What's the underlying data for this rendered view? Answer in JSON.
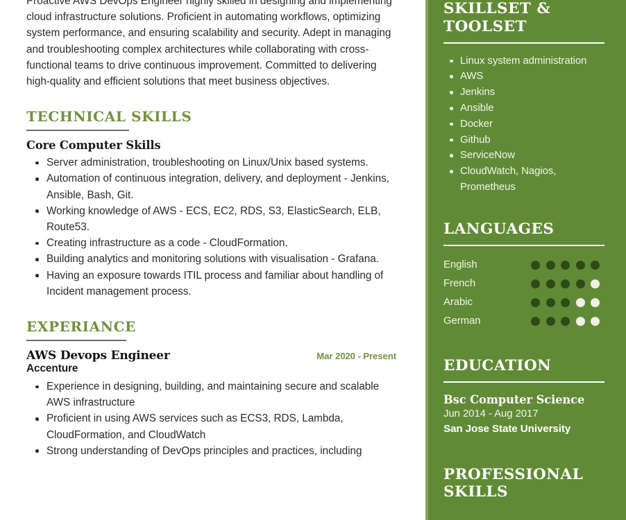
{
  "theme": {
    "accent_green": "#73913f",
    "sidebar_green": "#618a36",
    "sidebar_edge_green": "#87a35c",
    "dot_filled": "#2f4a14",
    "dot_empty": "#eef1e4",
    "rule_gray": "#6d6d6d",
    "body_text": "#2b2b2b"
  },
  "main": {
    "summary": "Proactive AWS DevOps Engineer highly skilled in designing and implementing cloud infrastructure solutions. Proficient in automating workflows, optimizing system performance, and ensuring scalability and security. Adept in managing and troubleshooting complex architectures while collaborating with cross-functional teams to drive continuous improvement. Committed to delivering high-quality and efficient solutions that meet business objectives.",
    "technical_skills": {
      "heading": "TECHNICAL SKILLS",
      "subheading": "Core Computer Skills",
      "bullets": [
        "Server administration, troubleshooting on Linux/Unix based systems.",
        "Automation of continuous integration, delivery, and deployment - Jenkins, Ansible, Bash, Git.",
        "Working knowledge of AWS - ECS, EC2, RDS, S3, ElasticSearch, ELB, Route53.",
        "Creating infrastructure as a code - CloudFormation.",
        "Building analytics and monitoring solutions with visualisation - Grafana.",
        "Having an exposure towards ITIL process and familiar about handling of Incident management process."
      ]
    },
    "experience": {
      "heading": "EXPERIANCE",
      "jobs": [
        {
          "title": "AWS Devops Engineer",
          "date": "Mar 2020 - Present",
          "company": "Accenture",
          "bullets": [
            "Experience in designing, building, and maintaining secure and scalable AWS infrastructure",
            "Proficient in using AWS services such as ECS3, RDS, Lambda, CloudFormation, and CloudWatch",
            "Strong understanding of DevOps principles and practices, including"
          ]
        }
      ]
    }
  },
  "sidebar": {
    "skillset": {
      "heading": "SKILLSET & TOOLSET",
      "items": [
        "Linux system administration",
        "AWS",
        "Jenkins",
        "Ansible",
        "Docker",
        "Github",
        "ServiceNow",
        "CloudWatch, Nagios, Prometheus"
      ]
    },
    "languages": {
      "heading": "LANGUAGES",
      "max_rating": 5,
      "items": [
        {
          "name": "English",
          "rating": 5
        },
        {
          "name": "French",
          "rating": 4
        },
        {
          "name": "Arabic",
          "rating": 3
        },
        {
          "name": "German",
          "rating": 3
        }
      ]
    },
    "education": {
      "heading": "EDUCATION",
      "entries": [
        {
          "degree": "Bsc Computer Science",
          "dates": "Jun 2014 - Aug 2017",
          "school": "San Jose State University"
        }
      ]
    },
    "professional_skills": {
      "heading": "PROFESSIONAL SKILLS"
    }
  }
}
